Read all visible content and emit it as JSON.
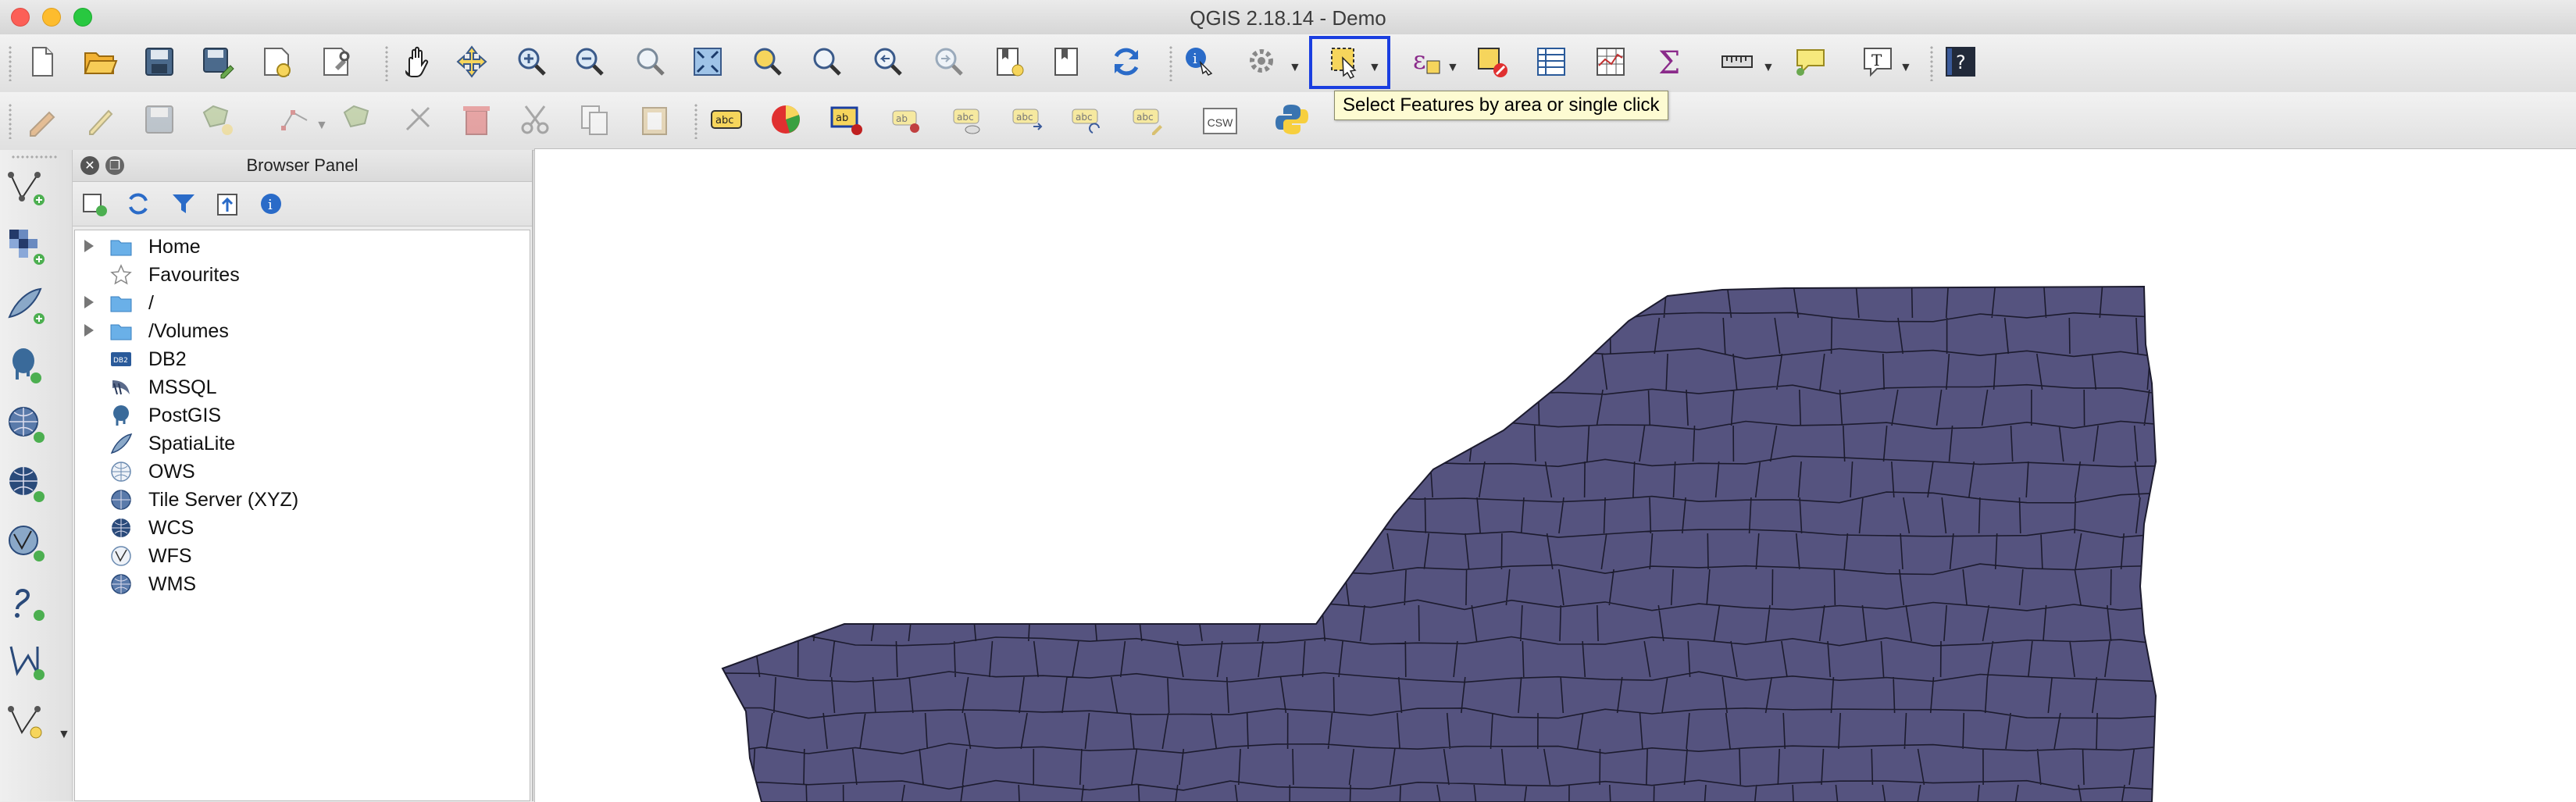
{
  "window": {
    "title": "QGIS 2.18.14 - Demo"
  },
  "tooltip": {
    "text": "Select Features by area or single click"
  },
  "toolbar1": {
    "buttons": [
      "new-project-icon",
      "open-project-icon",
      "save-project-icon",
      "save-as-icon",
      "new-print-composer-icon",
      "composer-manager-icon",
      "pan-icon",
      "pan-to-selection-icon",
      "zoom-in-icon",
      "zoom-out-icon",
      "zoom-native-icon",
      "zoom-full-icon",
      "zoom-to-selection-icon",
      "zoom-to-layer-icon",
      "zoom-last-icon",
      "zoom-next-icon",
      "new-bookmark-icon",
      "show-bookmarks-icon",
      "refresh-icon",
      "identify-icon",
      "action-icon",
      "select-features-icon",
      "select-expression-icon",
      "deselect-icon",
      "attribute-table-icon",
      "field-calculator-icon",
      "statistics-icon",
      "measure-icon",
      "map-tips-icon",
      "text-annotation-icon",
      "help-icon"
    ]
  },
  "toolbar2": {
    "buttons": [
      "current-edits-icon",
      "toggle-editing-icon",
      "save-edits-icon",
      "add-feature-icon",
      "vertex-tool-icon",
      "delete-selected-icon",
      "cut-features-icon",
      "copy-features-icon",
      "paste-features-icon",
      "label-icon",
      "diagram-icon",
      "pin-labels-icon",
      "show-hide-labels-icon",
      "move-label-icon",
      "rotate-label-icon",
      "change-label-icon",
      "csw-icon",
      "python-console-icon"
    ],
    "csw_label": "CSW"
  },
  "browser_panel": {
    "title": "Browser Panel",
    "items": [
      {
        "label": "Home",
        "icon": "folder-icon",
        "expandable": true
      },
      {
        "label": "Favourites",
        "icon": "star-icon",
        "expandable": false
      },
      {
        "label": "/",
        "icon": "folder-icon",
        "expandable": true
      },
      {
        "label": "/Volumes",
        "icon": "folder-icon",
        "expandable": true
      },
      {
        "label": "DB2",
        "icon": "db2-icon",
        "expandable": false
      },
      {
        "label": "MSSQL",
        "icon": "mssql-icon",
        "expandable": false
      },
      {
        "label": "PostGIS",
        "icon": "postgis-icon",
        "expandable": false
      },
      {
        "label": "SpatiaLite",
        "icon": "spatialite-icon",
        "expandable": false
      },
      {
        "label": "OWS",
        "icon": "ows-icon",
        "expandable": false
      },
      {
        "label": "Tile Server (XYZ)",
        "icon": "xyz-icon",
        "expandable": false
      },
      {
        "label": "WCS",
        "icon": "wcs-icon",
        "expandable": false
      },
      {
        "label": "WFS",
        "icon": "wfs-icon",
        "expandable": false
      },
      {
        "label": "WMS",
        "icon": "wms-icon",
        "expandable": false
      }
    ],
    "db2_badge": "DB2"
  },
  "colors": {
    "map_fill": "#55537f",
    "map_stroke": "#1c1b2e",
    "highlight": "#1a3ee0"
  }
}
